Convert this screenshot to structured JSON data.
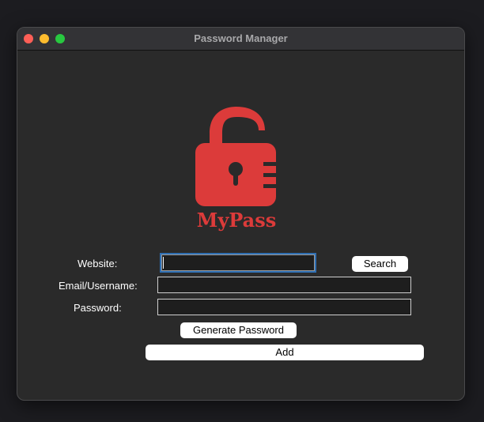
{
  "window": {
    "title": "Password Manager"
  },
  "logo": {
    "text": "MyPass",
    "color": "#dc3b3a"
  },
  "form": {
    "website_label": "Website:",
    "email_label": "Email/Username:",
    "password_label": "Password:",
    "website_value": "",
    "email_value": "",
    "password_value": ""
  },
  "buttons": {
    "search": "Search",
    "generate": "Generate Password",
    "add": "Add"
  }
}
